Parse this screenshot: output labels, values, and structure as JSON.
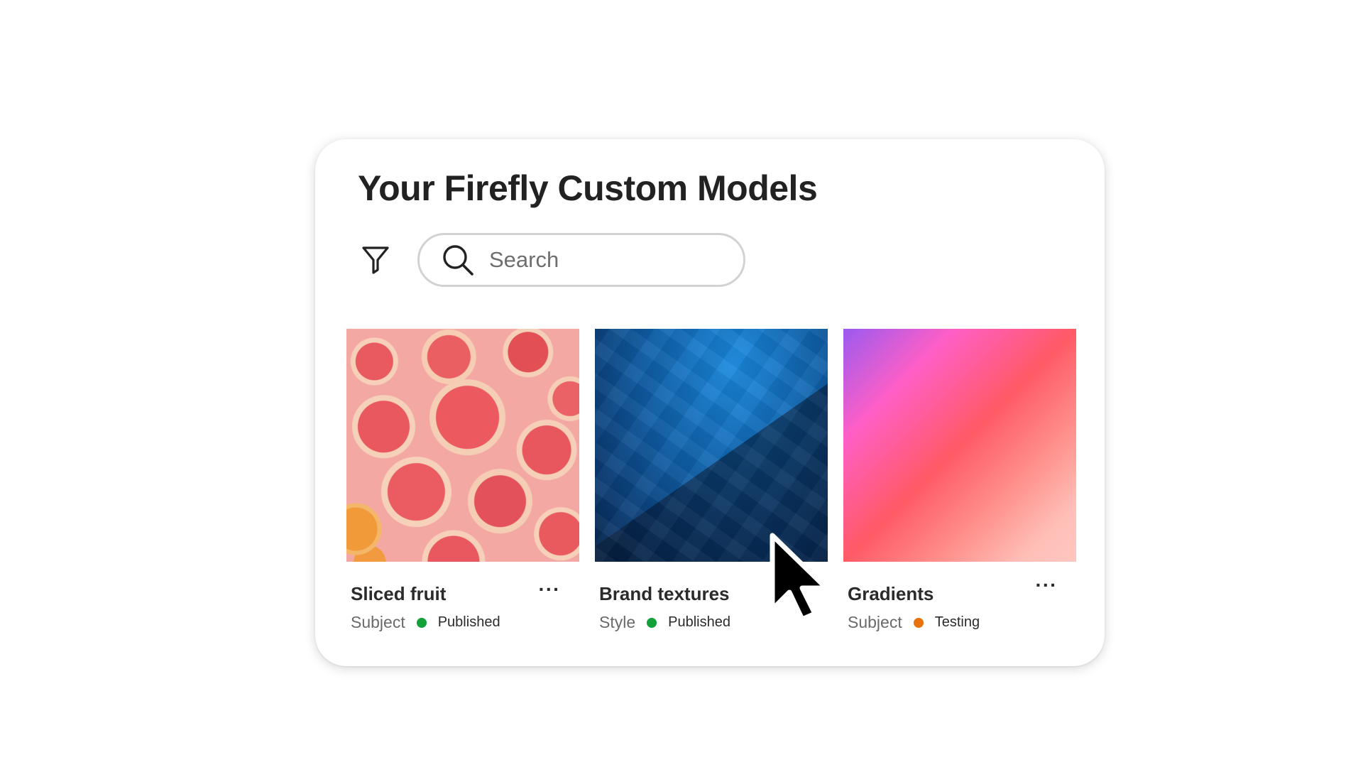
{
  "panel": {
    "title": "Your Firefly Custom Models",
    "filter_icon": "filter-icon",
    "search": {
      "icon": "search-icon",
      "placeholder": "Search",
      "value": ""
    }
  },
  "models": [
    {
      "name": "Sliced fruit",
      "type": "Subject",
      "status": "Published",
      "status_color": "#12a038",
      "thumbnail": "grapefruit-slices-photo"
    },
    {
      "name": "Brand textures",
      "type": "Style",
      "status": "Published",
      "status_color": "#12a038",
      "thumbnail": "blue-texture"
    },
    {
      "name": "Gradients",
      "type": "Subject",
      "status": "Testing",
      "status_color": "#e8730e",
      "thumbnail": "pink-gradient"
    }
  ],
  "more_icon": "more-options-icon",
  "cursor_icon": "mouse-pointer-icon",
  "colors": {
    "published": "#12a038",
    "testing": "#e8730e",
    "title": "#222222"
  }
}
